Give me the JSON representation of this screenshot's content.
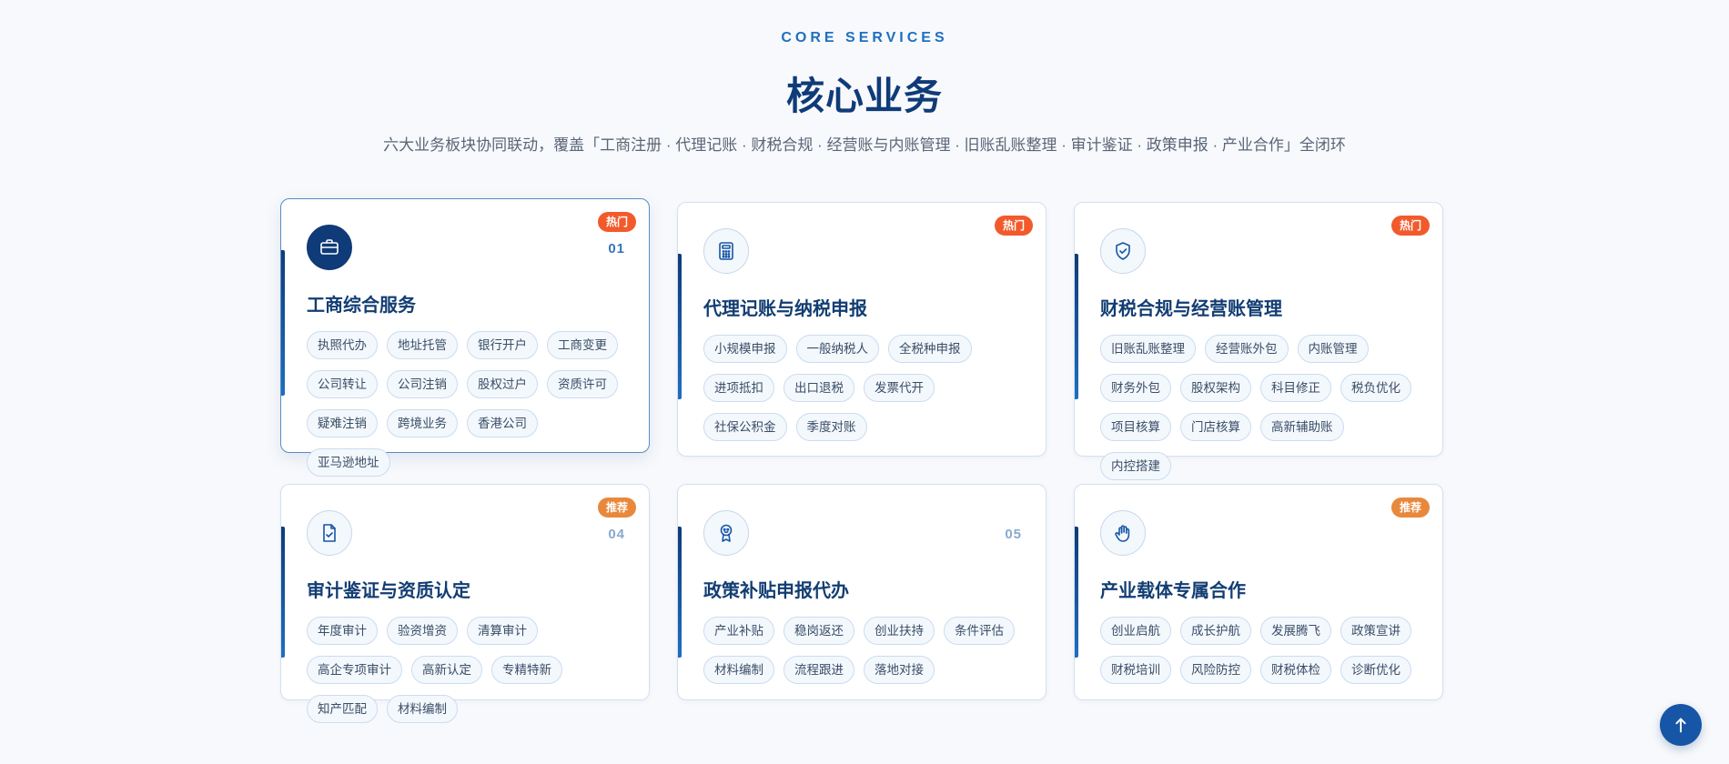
{
  "header": {
    "eyebrow": "CORE SERVICES",
    "title": "核心业务",
    "subtitle": "六大业务板块协同联动，覆盖「工商注册 · 代理记账 · 财税合规 · 经营账与内账管理 · 旧账乱账整理 · 审计鉴证 · 政策申报 · 产业合作」全闭环"
  },
  "cards": [
    {
      "title": "工商综合服务",
      "badge": "热门",
      "badge_type": "hot",
      "number": "01",
      "icon": "briefcase-icon",
      "tags": [
        "执照代办",
        "地址托管",
        "银行开户",
        "工商变更",
        "公司转让",
        "公司注销",
        "股权过户",
        "资质许可",
        "疑难注销",
        "跨境业务",
        "香港公司",
        "亚马逊地址"
      ]
    },
    {
      "title": "代理记账与纳税申报",
      "badge": "热门",
      "badge_type": "hot",
      "number": "",
      "icon": "calculator-icon",
      "tags": [
        "小规模申报",
        "一般纳税人",
        "全税种申报",
        "进项抵扣",
        "出口退税",
        "发票代开",
        "社保公积金",
        "季度对账"
      ]
    },
    {
      "title": "财税合规与经营账管理",
      "badge": "热门",
      "badge_type": "hot",
      "number": "",
      "icon": "shield-check-icon",
      "tags": [
        "旧账乱账整理",
        "经营账外包",
        "内账管理",
        "财务外包",
        "股权架构",
        "科目修正",
        "税负优化",
        "项目核算",
        "门店核算",
        "高新辅助账",
        "内控搭建"
      ]
    },
    {
      "title": "审计鉴证与资质认定",
      "badge": "推荐",
      "badge_type": "rec",
      "number": "04",
      "icon": "document-check-icon",
      "tags": [
        "年度审计",
        "验资增资",
        "清算审计",
        "高企专项审计",
        "高新认定",
        "专精特新",
        "知产匹配",
        "材料编制"
      ]
    },
    {
      "title": "政策补贴申报代办",
      "badge": "",
      "badge_type": "",
      "number": "05",
      "icon": "award-icon",
      "tags": [
        "产业补贴",
        "稳岗返还",
        "创业扶持",
        "条件评估",
        "材料编制",
        "流程跟进",
        "落地对接"
      ]
    },
    {
      "title": "产业载体专属合作",
      "badge": "推荐",
      "badge_type": "rec",
      "number": "",
      "icon": "hand-icon",
      "tags": [
        "创业启航",
        "成长护航",
        "发展腾飞",
        "政策宣讲",
        "财税培训",
        "风险防控",
        "财税体检",
        "诊断优化"
      ]
    }
  ],
  "back_to_top": {
    "icon": "arrow-up-icon"
  }
}
